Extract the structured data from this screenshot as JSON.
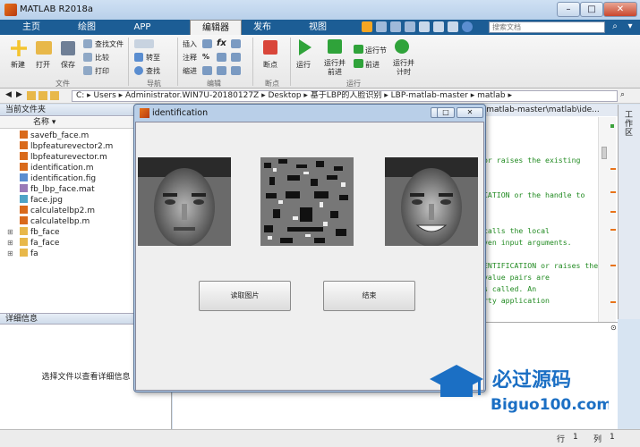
{
  "window": {
    "title": "MATLAB R2018a",
    "min": "–",
    "max": "□",
    "close": "✕"
  },
  "tabs": [
    {
      "label": "主页"
    },
    {
      "label": "绘图"
    },
    {
      "label": "APP"
    },
    {
      "label": "编辑器"
    },
    {
      "label": "发布"
    },
    {
      "label": "视图"
    }
  ],
  "search": {
    "placeholder": "搜索文档"
  },
  "toolstrip": {
    "file": {
      "new": "新建",
      "open": "打开",
      "save": "保存",
      "find_files": "查找文件",
      "compare": "比较",
      "print": "打印",
      "label": "文件"
    },
    "navigate": {
      "goto": "转至",
      "find": "查找",
      "label": "导航"
    },
    "edit": {
      "insert": "插入",
      "fx": "fx",
      "comment": "注释",
      "percent": "%",
      "indent": "缩进",
      "label": "编辑"
    },
    "breakpoints": {
      "bp": "断点",
      "label": "断点"
    },
    "run": {
      "run": "运行",
      "run_advance": "运行并\n前进",
      "run_section": "运行节",
      "advance": "前进",
      "run_time": "运行并\n计时",
      "label": "运行"
    }
  },
  "path": {
    "value": "C: ▸ Users ▸ Administrator.WIN7U-20180127Z ▸ Desktop ▸ 基于LBP的人脸识别 ▸ LBP-matlab-master ▸ matlab ▸"
  },
  "current_folder": {
    "header": "当前文件夹",
    "name_col": "名称 ▾",
    "files": [
      {
        "name": "savefb_face.m",
        "type": "m"
      },
      {
        "name": "lbpfeaturevector2.m",
        "type": "m"
      },
      {
        "name": "lbpfeaturevector.m",
        "type": "m"
      },
      {
        "name": "identification.m",
        "type": "m"
      },
      {
        "name": "identification.fig",
        "type": "fig"
      },
      {
        "name": "fb_lbp_face.mat",
        "type": "mat"
      },
      {
        "name": "face.jpg",
        "type": "jpg"
      },
      {
        "name": "calculatelbp2.m",
        "type": "m"
      },
      {
        "name": "calculatelbp.m",
        "type": "m"
      }
    ],
    "folders": [
      {
        "name": "fb_face"
      },
      {
        "name": "fa_face"
      },
      {
        "name": "fa"
      }
    ]
  },
  "details": {
    "header": "详细信息",
    "placeholder": "选择文件以查看详细信息"
  },
  "editor": {
    "tab_label": "-matlab-master\\matlab\\ide...",
    "lines": [
      "or raises the existing",
      "",
      "CATION or the handle to",
      "",
      "",
      " calls the local",
      "ven input arguments.",
      "",
      "ENTIFICATION or raises the",
      "value pairs are",
      "s called.  An",
      "rty application"
    ]
  },
  "right_strip": {
    "label": "工作区"
  },
  "status": {
    "row_label": "行",
    "row": "1",
    "col_label": "列",
    "col": "1"
  },
  "figure": {
    "title": "identification",
    "buttons": {
      "read_image": "读取图片",
      "finish": "结束"
    }
  },
  "watermark": {
    "brand": "必过源码",
    "url": "Biguo100.com"
  },
  "colors": {
    "tab_bar": "#1c5d95",
    "code_comment": "#228b22",
    "accent_orange": "#e8731a"
  }
}
